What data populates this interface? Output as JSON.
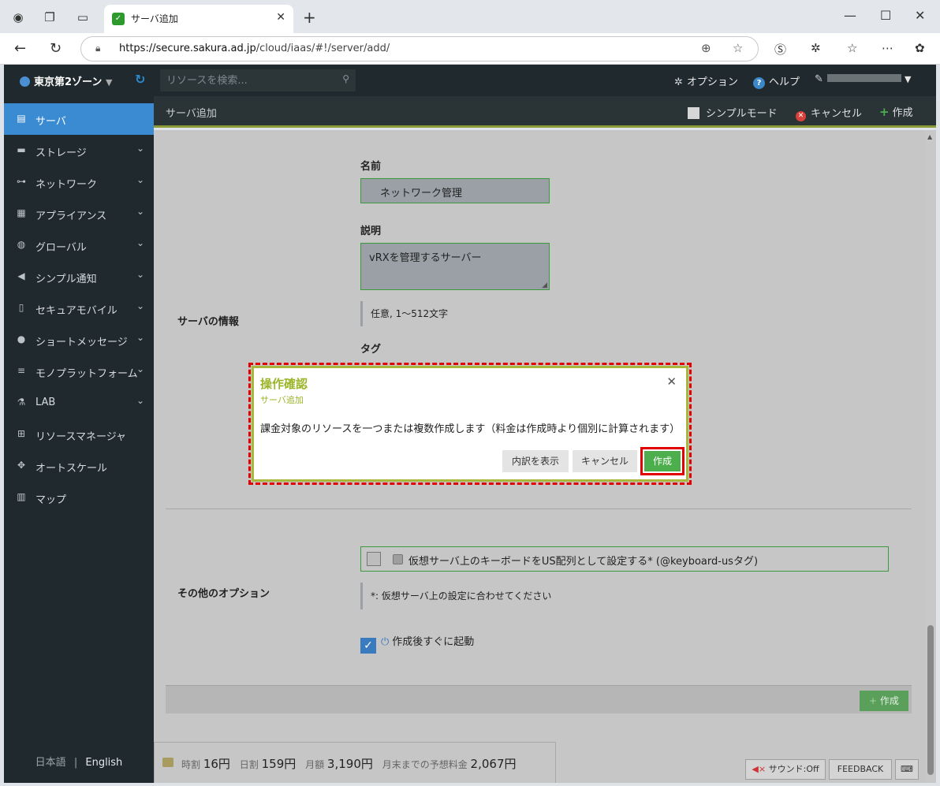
{
  "browser": {
    "tab_title": "サーバ追加",
    "url_domain": "https://secure.sakura.ad.jp",
    "url_path": "/cloud/iaas/#!/server/add/"
  },
  "header": {
    "zone": "東京第2ゾーン",
    "search_placeholder": "リソースを検索...",
    "options": "オプション",
    "help": "ヘルプ"
  },
  "sidebar": {
    "items": [
      {
        "label": "サーバ",
        "icon": "server-icon",
        "glyph": "▤"
      },
      {
        "label": "ストレージ",
        "icon": "storage-icon",
        "glyph": "▬"
      },
      {
        "label": "ネットワーク",
        "icon": "network-icon",
        "glyph": "⊶"
      },
      {
        "label": "アプライアンス",
        "icon": "appliance-icon",
        "glyph": "▦"
      },
      {
        "label": "グローバル",
        "icon": "globe-icon",
        "glyph": "◍"
      },
      {
        "label": "シンプル通知",
        "icon": "megaphone-icon",
        "glyph": "◀"
      },
      {
        "label": "セキュアモバイル",
        "icon": "mobile-icon",
        "glyph": "▯"
      },
      {
        "label": "ショートメッセージ",
        "icon": "chat-icon",
        "glyph": "●"
      },
      {
        "label": "モノプラットフォーム",
        "icon": "stack-icon",
        "glyph": "≡"
      },
      {
        "label": "LAB",
        "icon": "flask-icon",
        "glyph": "⚗"
      },
      {
        "label": "リソースマネージャ",
        "icon": "hierarchy-icon",
        "glyph": "⊞"
      },
      {
        "label": "オートスケール",
        "icon": "arrows-icon",
        "glyph": "✥"
      },
      {
        "label": "マップ",
        "icon": "map-icon",
        "glyph": "▥"
      }
    ],
    "lang_ja": "日本語",
    "lang_sep": "|",
    "lang_en": "English"
  },
  "subheader": {
    "title": "サーバ追加",
    "simple_mode": "シンプルモード",
    "cancel": "キャンセル",
    "create": "作成"
  },
  "form": {
    "name_label": "名前",
    "name_value": "ネットワーク管理",
    "desc_label": "説明",
    "desc_value": "vRXを管理するサーバー",
    "desc_hint": "任意, 1〜512文字",
    "tag_label": "タグ",
    "section_info": "サーバの情報",
    "section_other": "その他のオプション",
    "keyboard_option": "仮想サーバ上のキーボードをUS配列として設定する* (@keyboard-usタグ)",
    "keyboard_hint": "*: 仮想サーバ上の設定に合わせてください",
    "boot_option": "作成後すぐに起動",
    "footer_create": "作成"
  },
  "pricing": {
    "hourly_label": "時割",
    "hourly_value": "16円",
    "daily_label": "日割",
    "daily_value": "159円",
    "monthly_label": "月額",
    "monthly_value": "3,190円",
    "estimate_label": "月末までの予想料金",
    "estimate_value": "2,067円"
  },
  "status": {
    "sound": "サウンド:Off",
    "feedback": "FEEDBACK"
  },
  "modal": {
    "title": "操作確認",
    "subtitle": "サーバ追加",
    "body": "課金対象のリソースを一つまたは複数作成します（料金は作成時より個別に計算されます）",
    "breakdown": "内訳を表示",
    "cancel": "キャンセル",
    "create": "作成"
  }
}
